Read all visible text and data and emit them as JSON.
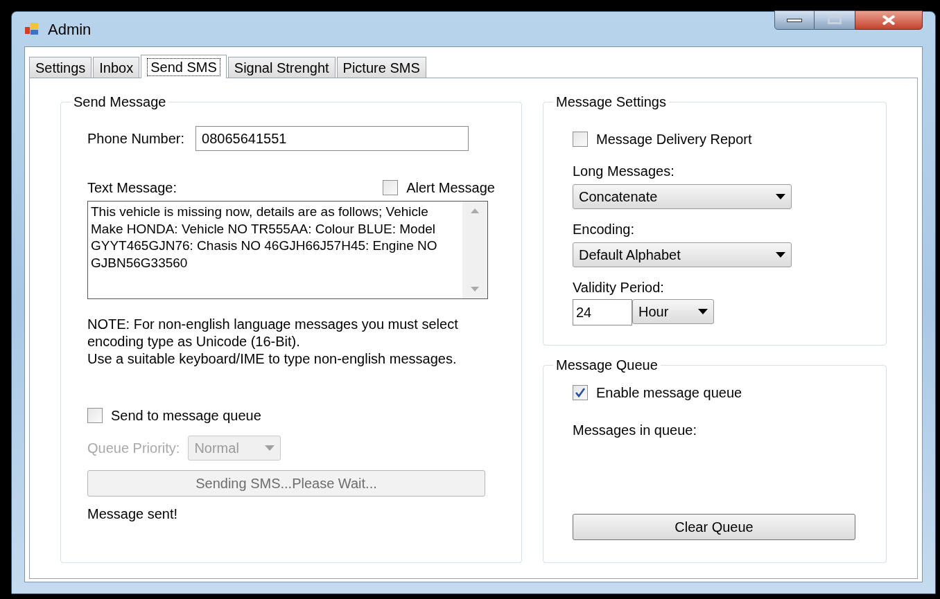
{
  "window": {
    "title": "Admin"
  },
  "tabs": [
    {
      "label": "Settings",
      "selected": false
    },
    {
      "label": "Inbox",
      "selected": false
    },
    {
      "label": "Send SMS",
      "selected": true
    },
    {
      "label": "Signal Strenght",
      "selected": false
    },
    {
      "label": "Picture SMS",
      "selected": false
    }
  ],
  "send_message": {
    "title": "Send Message",
    "phone_label": "Phone Number:",
    "phone_value": "08065641551",
    "text_label": "Text Message:",
    "alert": {
      "label": "Alert Message",
      "checked": false
    },
    "message": "This vehicle is missing now, details are as follows; Vehicle Make HONDA: Vehicle NO TR555AA: Colour BLUE: Model GYYT465GJN76: Chasis NO 46GJH66J57H45: Engine NO GJBN56G33560",
    "note": [
      "NOTE: For non-english language messages you must select encoding type as Unicode (16-Bit).",
      "Use a suitable keyboard/IME to type non-english messages."
    ],
    "send_to_queue": {
      "label": "Send to message queue",
      "checked": false
    },
    "queue_priority": {
      "label": "Queue Priority:",
      "value": "Normal",
      "disabled": true
    },
    "send_button": {
      "label": "Sending SMS...Please Wait...",
      "disabled": true
    },
    "status": "Message sent!"
  },
  "message_settings": {
    "title": "Message Settings",
    "delivery_report": {
      "label": "Message Delivery Report",
      "checked": false
    },
    "long_messages": {
      "label": "Long Messages:",
      "value": "Concatenate"
    },
    "encoding": {
      "label": "Encoding:",
      "value": "Default Alphabet"
    },
    "validity": {
      "label": "Validity Period:",
      "value": "24",
      "unit": "Hour"
    }
  },
  "message_queue": {
    "title": "Message Queue",
    "enable": {
      "label": "Enable message queue",
      "checked": true
    },
    "queue_label": "Messages in queue:",
    "clear_button": "Clear Queue"
  }
}
